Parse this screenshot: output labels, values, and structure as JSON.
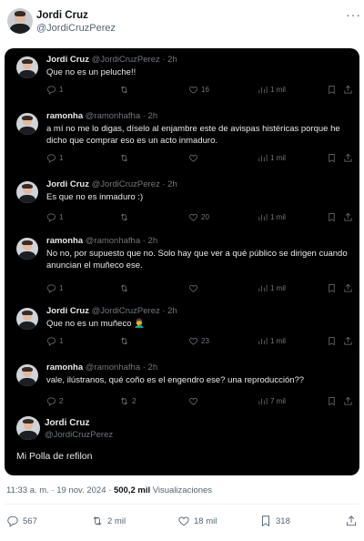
{
  "header": {
    "name": "Jordi Cruz",
    "handle": "@JordiCruzPerez",
    "more": "···"
  },
  "thread": [
    {
      "name": "Jordi Cruz",
      "handle": "@JordiCruzPerez · 2h",
      "text": "Que no es un peluche!!",
      "reply": "1",
      "retweet": "",
      "like": "16",
      "views": "1 mil"
    },
    {
      "name": "ramonha",
      "handle": "@ramonhafha · 2h",
      "text": "a mí no me lo digas, díselo al enjambre este de avispas histéricas porque he dicho que comprar eso es un acto inmaduro.",
      "reply": "1",
      "retweet": "",
      "like": "",
      "views": "1 mil"
    },
    {
      "name": "Jordi Cruz",
      "handle": "@JordiCruzPerez · 2h",
      "text": "Es que no es inmaduro :)",
      "reply": "1",
      "retweet": "",
      "like": "20",
      "views": "1 mil"
    },
    {
      "name": "ramonha",
      "handle": "@ramonhafha · 2h",
      "text": "No no, por supuesto que no. Solo hay que ver a qué público se dirigen cuando anuncian el muñeco ese.",
      "reply": "1",
      "retweet": "",
      "like": "",
      "views": "1 mil"
    },
    {
      "name": "Jordi Cruz",
      "handle": "@JordiCruzPerez · 2h",
      "text": "Que no es un muñeco 🤦‍♂️",
      "reply": "1",
      "retweet": "",
      "like": "23",
      "views": "1 mil"
    },
    {
      "name": "ramonha",
      "handle": "@ramonhafha · 2h",
      "text": "vale, ilústranos, qué coño es el engendro ese? una reproducción??",
      "reply": "2",
      "retweet": "2",
      "like": "",
      "views": "7 mil"
    }
  ],
  "main_tweet": {
    "name": "Jordi Cruz",
    "handle": "@JordiCruzPerez",
    "text": "Mi Polla de refilon"
  },
  "meta": {
    "time": "11:33 a. m. · 19 nov. 2024 · ",
    "views_count": "500,2 mil",
    "views_label": " Visualizaciones"
  },
  "stats": {
    "replies": "567",
    "retweets": "2 mil",
    "likes": "18 mil",
    "bookmarks": "318"
  },
  "icons": [
    "reply-icon",
    "retweet-icon",
    "like-icon",
    "views-icon",
    "bookmark-icon",
    "share-icon"
  ]
}
